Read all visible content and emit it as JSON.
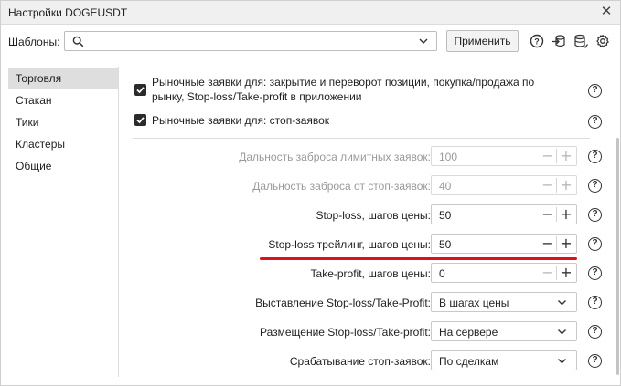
{
  "window": {
    "title": "Настройки DOGEUSDT",
    "close_glyph": "✕"
  },
  "toolbar": {
    "templates_label": "Шаблоны:",
    "search_value": "",
    "search_placeholder": "",
    "apply_label": "Применить",
    "icons": [
      "help-icon",
      "import-icon",
      "database-icon",
      "gear-icon"
    ]
  },
  "sidebar": {
    "items": [
      {
        "label": "Торговля",
        "active": true
      },
      {
        "label": "Стакан",
        "active": false
      },
      {
        "label": "Тики",
        "active": false
      },
      {
        "label": "Кластеры",
        "active": false
      },
      {
        "label": "Общие",
        "active": false
      }
    ]
  },
  "checkboxes": [
    {
      "label_line1": "Рыночные заявки для: закрытие и переворот позиции, покупка/продажа по",
      "label_line2": "рынку, Stop-loss/Take-profit в приложении",
      "checked": true
    },
    {
      "label_line1": "Рыночные заявки для: стоп-заявок",
      "label_line2": "",
      "checked": true
    }
  ],
  "fields": [
    {
      "label": "Дальность заброса лимитных заявок:",
      "value": "100",
      "kind": "spin",
      "disabled": true
    },
    {
      "label": "Дальность заброса от стоп-заявок:",
      "value": "40",
      "kind": "spin",
      "disabled": true
    },
    {
      "label": "Stop-loss, шагов цены:",
      "value": "50",
      "kind": "spin",
      "disabled": false
    },
    {
      "label": "Stop-loss трейлинг, шагов цены:",
      "value": "50",
      "kind": "spin",
      "disabled": false,
      "highlighted": true
    },
    {
      "label": "Take-profit, шагов цены:",
      "value": "0",
      "kind": "spin",
      "disabled": false
    },
    {
      "label": "Выставление Stop-loss/Take-Profit:",
      "value": "В шагах цены",
      "kind": "select"
    },
    {
      "label": "Размещение Stop-loss/Take-profit:",
      "value": "На сервере",
      "kind": "select"
    },
    {
      "label": "Срабатывание стоп-заявок:",
      "value": "По сделкам",
      "kind": "select"
    }
  ],
  "glyphs": {
    "minus": "−",
    "plus": "+",
    "help": "?"
  },
  "colors": {
    "highlight_underline": "#e0101a",
    "active_sidebar": "#dedede"
  }
}
